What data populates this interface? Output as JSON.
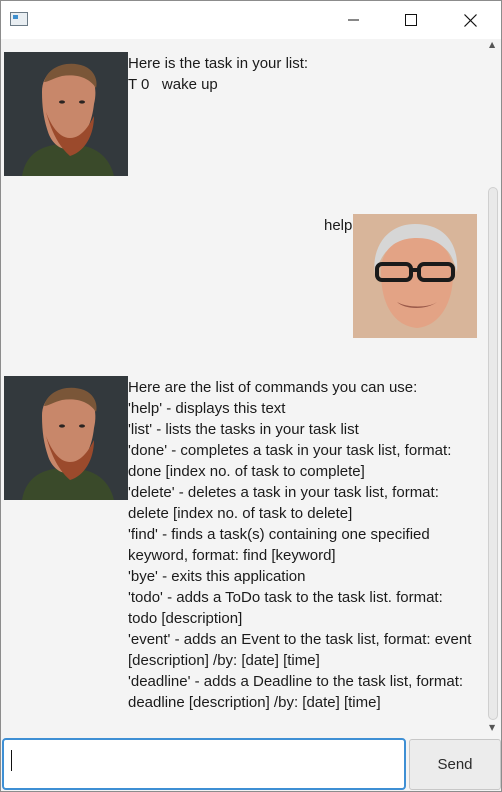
{
  "window": {
    "minimize_icon": "minimize-icon",
    "maximize_icon": "maximize-icon",
    "close_icon": "close-icon"
  },
  "messages": [
    {
      "sender": "duke",
      "lines": [
        "Here is the task in your list:",
        "T 0   wake up"
      ]
    },
    {
      "sender": "user",
      "lines": [
        "help"
      ]
    },
    {
      "sender": "duke",
      "lines": [
        "Here are the list of commands you can use:",
        "'help' - displays this text",
        "'list' - lists the tasks in your task list",
        "'done' - completes a task in your task list, format:",
        "done [index no. of task to complete]",
        "'delete' - deletes a task in your task list, format:",
        "delete [index no. of task to delete]",
        "'find' - finds a task(s) containing one specified",
        "keyword, format: find [keyword]",
        "'bye' - exits this application",
        "'todo' - adds a ToDo task to the task list. format:",
        "todo [description]",
        "'event' - adds an Event to the task list, format: event",
        "[description] /by: [date] [time]",
        "'deadline' - adds a Deadline to the task list, format:",
        "deadline [description] /by: [date] [time]"
      ]
    }
  ],
  "input": {
    "value": "",
    "placeholder": ""
  },
  "send_button": {
    "label": "Send"
  },
  "colors": {
    "input_focus_border": "#3e8fd4",
    "background": "#f4f4f4"
  }
}
